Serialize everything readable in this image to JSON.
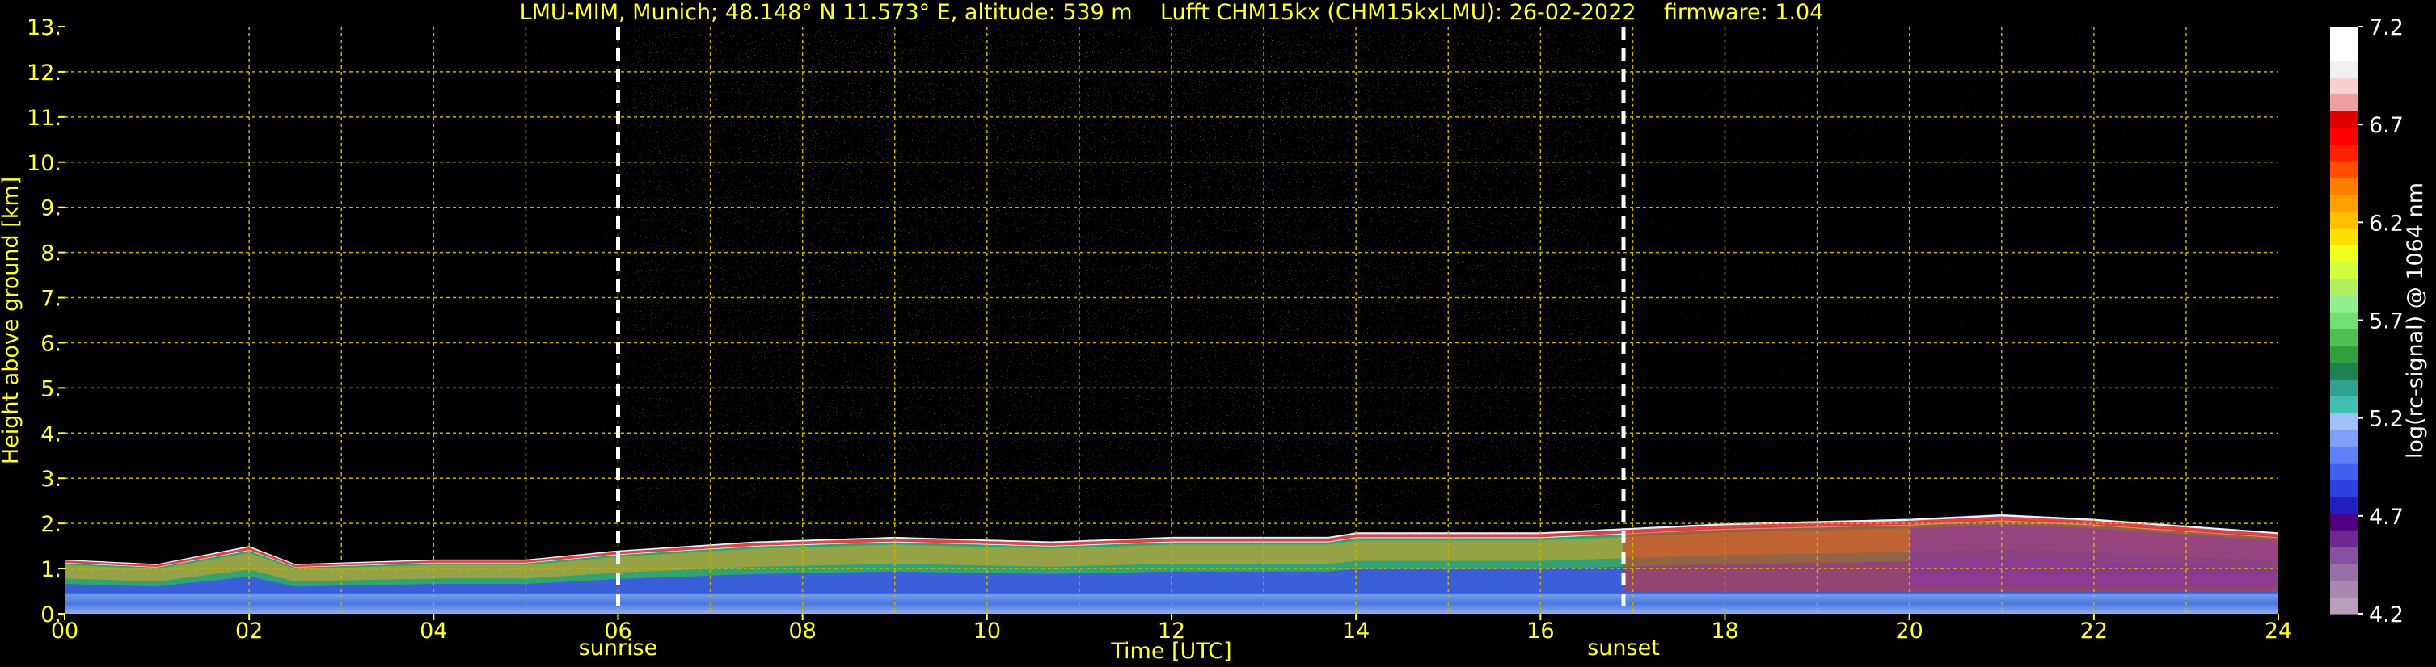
{
  "chart_data": {
    "type": "heatmap",
    "title": "LMU-MIM, Munich; 48.148° N 11.573° E, altitude: 539 m    Lufft CHM15kx (CHM15kxLMU): 26-02-2022    firmware: 1.04",
    "xlabel": "Time [UTC]",
    "ylabel": "Height above ground [km]",
    "xlim": [
      0,
      24
    ],
    "ylim": [
      0,
      13
    ],
    "x_ticks": [
      "00",
      "02",
      "04",
      "06",
      "08",
      "10",
      "12",
      "14",
      "16",
      "18",
      "20",
      "22",
      "24"
    ],
    "y_ticks": [
      "0.",
      "1.",
      "2.",
      "3.",
      "4.",
      "5.",
      "6.",
      "7.",
      "8.",
      "9.",
      "10.",
      "11.",
      "12.",
      "13."
    ],
    "grid": true,
    "annotations": [
      {
        "label": "sunrise",
        "x": 6.0
      },
      {
        "label": "sunset",
        "x": 16.9
      }
    ],
    "colorbar": {
      "label": "log(rc-signal) @ 1064 nm",
      "ticks": [
        "4.2",
        "4.7",
        "5.2",
        "5.7",
        "6.2",
        "6.7",
        "7.2"
      ],
      "range": [
        4.2,
        7.2
      ]
    },
    "boundary_layer_top_km": [
      [
        0.0,
        1.2
      ],
      [
        1.0,
        1.1
      ],
      [
        2.0,
        1.5
      ],
      [
        2.5,
        1.1
      ],
      [
        4.0,
        1.2
      ],
      [
        5.0,
        1.2
      ],
      [
        6.0,
        1.4
      ],
      [
        7.5,
        1.6
      ],
      [
        9.0,
        1.7
      ],
      [
        10.7,
        1.6
      ],
      [
        12.0,
        1.7
      ],
      [
        13.7,
        1.7
      ],
      [
        14.0,
        1.8
      ],
      [
        16.0,
        1.8
      ],
      [
        18.0,
        2.0
      ],
      [
        20.0,
        2.1
      ],
      [
        21.0,
        2.2
      ],
      [
        22.0,
        2.1
      ],
      [
        24.0,
        1.8
      ]
    ]
  },
  "colors": {
    "background": "#000000",
    "axis_text": "#ffff33",
    "grid": "#c8b400",
    "colorbar_text": "#ffffff",
    "marker_line": "#ffffff"
  }
}
